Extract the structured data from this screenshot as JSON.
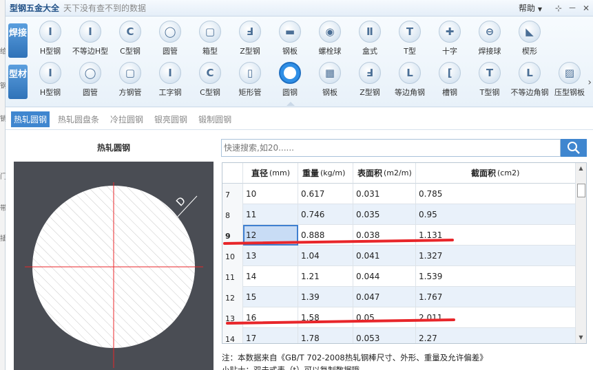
{
  "app": {
    "title": "型钢五金大全",
    "slogan": "天下没有查不到的数据"
  },
  "menu": {
    "help": "帮助"
  },
  "window_controls": {
    "pin": "⊹",
    "minimize": "－",
    "close": "✕"
  },
  "bg_window_glyphs": [
    "给",
    "钢",
    "销",
    "门",
    "带",
    "插"
  ],
  "categories": [
    {
      "label": "焊接",
      "icons": [
        {
          "label": "H型钢",
          "icon": "h-beam-icon",
          "glyph": "I"
        },
        {
          "label": "不等边H型",
          "icon": "unequal-h-beam-icon",
          "glyph": "I"
        },
        {
          "label": "C型钢",
          "icon": "c-channel-icon",
          "glyph": "C"
        },
        {
          "label": "圆管",
          "icon": "round-tube-icon",
          "glyph": "◯"
        },
        {
          "label": "箱型",
          "icon": "box-section-icon",
          "glyph": "▢"
        },
        {
          "label": "Z型钢",
          "icon": "z-section-icon",
          "glyph": "Ⅎ"
        },
        {
          "label": "钢板",
          "icon": "steel-plate-icon",
          "glyph": "▬"
        },
        {
          "label": "螺栓球",
          "icon": "bolt-ball-icon",
          "glyph": "◉"
        },
        {
          "label": "盒式",
          "icon": "box-type-icon",
          "glyph": "Ⅱ"
        },
        {
          "label": "T型",
          "icon": "t-section-icon",
          "glyph": "T"
        },
        {
          "label": "十字",
          "icon": "cross-section-icon",
          "glyph": "✚"
        },
        {
          "label": "焊接球",
          "icon": "welded-ball-icon",
          "glyph": "⊖"
        },
        {
          "label": "楔形",
          "icon": "wedge-icon",
          "glyph": "◣"
        }
      ]
    },
    {
      "label": "型材",
      "icons": [
        {
          "label": "H型钢",
          "icon": "h-beam-icon",
          "glyph": "I"
        },
        {
          "label": "圆管",
          "icon": "round-tube-icon",
          "glyph": "◯"
        },
        {
          "label": "方钢管",
          "icon": "square-tube-icon",
          "glyph": "▢"
        },
        {
          "label": "工字钢",
          "icon": "i-beam-icon",
          "glyph": "I"
        },
        {
          "label": "C型钢",
          "icon": "c-channel-icon",
          "glyph": "C"
        },
        {
          "label": "矩形管",
          "icon": "rectangular-tube-icon",
          "glyph": "▯"
        },
        {
          "label": "圆钢",
          "icon": "round-bar-icon",
          "glyph": "●"
        },
        {
          "label": "钢板",
          "icon": "steel-plate-icon",
          "glyph": "▦"
        },
        {
          "label": "Z型钢",
          "icon": "z-section-icon",
          "glyph": "Ⅎ"
        },
        {
          "label": "等边角钢",
          "icon": "equal-angle-icon",
          "glyph": "L"
        },
        {
          "label": "槽钢",
          "icon": "channel-icon",
          "glyph": "["
        },
        {
          "label": "T型钢",
          "icon": "t-section-icon",
          "glyph": "T"
        },
        {
          "label": "不等边角钢",
          "icon": "unequal-angle-icon",
          "glyph": "L"
        },
        {
          "label": "压型钢板",
          "icon": "profiled-sheet-icon",
          "glyph": "▨"
        }
      ]
    }
  ],
  "active_icon": "圆钢",
  "subtabs": [
    "热轧圆钢",
    "热轧圆盘条",
    "冷拉圆钢",
    "银亮圆钢",
    "锻制圆钢"
  ],
  "active_subtab": "热轧圆钢",
  "diagram": {
    "title": "热轧圆钢",
    "dim_label": "D"
  },
  "search": {
    "placeholder": "快速搜索,如20......"
  },
  "table": {
    "headers": [
      {
        "name": "直径",
        "unit": "(mm)"
      },
      {
        "name": "重量",
        "unit": "(kg/m)"
      },
      {
        "name": "表面积",
        "unit": "(m2/m)"
      },
      {
        "name": "截面积",
        "unit": "(cm2)"
      }
    ],
    "rows": [
      [
        "7",
        "10",
        "0.617",
        "0.031",
        "0.785"
      ],
      [
        "8",
        "11",
        "0.746",
        "0.035",
        "0.95"
      ],
      [
        "9",
        "12",
        "0.888",
        "0.038",
        "1.131"
      ],
      [
        "10",
        "13",
        "1.04",
        "0.041",
        "1.327"
      ],
      [
        "11",
        "14",
        "1.21",
        "0.044",
        "1.539"
      ],
      [
        "12",
        "15",
        "1.39",
        "0.047",
        "1.767"
      ],
      [
        "13",
        "16",
        "1.58",
        "0.05",
        "2.011"
      ],
      [
        "14",
        "17",
        "1.78",
        "0.053",
        "2.27"
      ]
    ],
    "selected_row": "9"
  },
  "note": "注：本数据来自《GB/T 702-2008热轧钢棒尺寸、外形、重量及允许偏差》",
  "note2": "小贴士：双击式表（t）可以复制数据哦",
  "colors": {
    "accent": "#3f86cf",
    "highlight": "#c8dcf5",
    "annotation": "#e8262a"
  }
}
